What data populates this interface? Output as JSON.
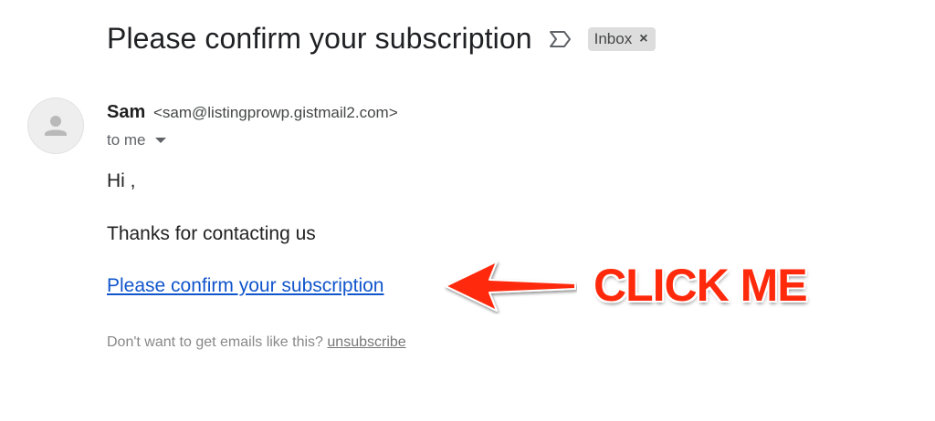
{
  "email": {
    "subject": "Please confirm your subscription",
    "label": "Inbox",
    "label_remove_icon": "×",
    "sender": {
      "name": "Sam",
      "email": "<sam@listingprowp.gistmail2.com>"
    },
    "recipient": "to me",
    "body": {
      "greeting": "Hi ,",
      "message": "Thanks for contacting us",
      "confirm_link": "Please confirm your subscription"
    },
    "footer": {
      "text": "Don't want to get emails like this? ",
      "unsubscribe": "unsubscribe"
    }
  },
  "annotation": {
    "callout": "CLICK ME",
    "color": "#ff2a0c"
  },
  "icons": {
    "importance": "label-important-outline-icon",
    "avatar": "default-person-avatar-icon",
    "caret": "chevron-down-icon",
    "arrow": "red-arrow-left-icon"
  },
  "colors": {
    "link": "#1155cc",
    "chip_bg": "#dddddd",
    "avatar_bg": "#eeeeee"
  }
}
